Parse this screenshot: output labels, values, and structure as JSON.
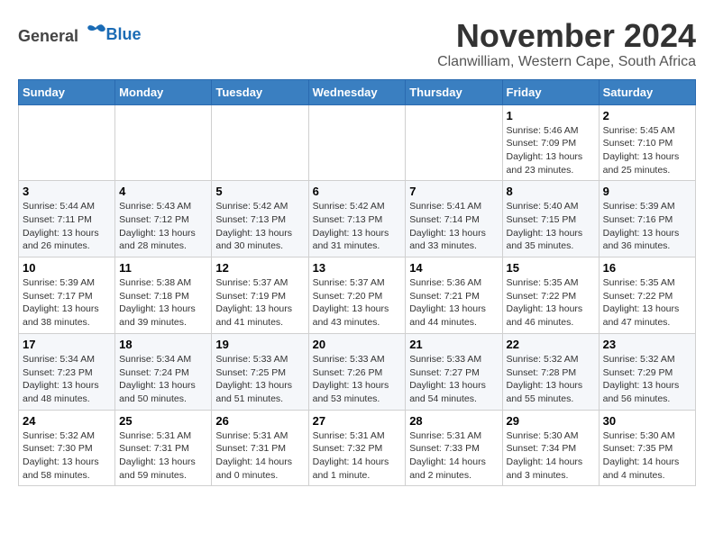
{
  "header": {
    "logo_general": "General",
    "logo_blue": "Blue",
    "month": "November 2024",
    "location": "Clanwilliam, Western Cape, South Africa"
  },
  "weekdays": [
    "Sunday",
    "Monday",
    "Tuesday",
    "Wednesday",
    "Thursday",
    "Friday",
    "Saturday"
  ],
  "weeks": [
    [
      {
        "day": "",
        "info": ""
      },
      {
        "day": "",
        "info": ""
      },
      {
        "day": "",
        "info": ""
      },
      {
        "day": "",
        "info": ""
      },
      {
        "day": "",
        "info": ""
      },
      {
        "day": "1",
        "info": "Sunrise: 5:46 AM\nSunset: 7:09 PM\nDaylight: 13 hours\nand 23 minutes."
      },
      {
        "day": "2",
        "info": "Sunrise: 5:45 AM\nSunset: 7:10 PM\nDaylight: 13 hours\nand 25 minutes."
      }
    ],
    [
      {
        "day": "3",
        "info": "Sunrise: 5:44 AM\nSunset: 7:11 PM\nDaylight: 13 hours\nand 26 minutes."
      },
      {
        "day": "4",
        "info": "Sunrise: 5:43 AM\nSunset: 7:12 PM\nDaylight: 13 hours\nand 28 minutes."
      },
      {
        "day": "5",
        "info": "Sunrise: 5:42 AM\nSunset: 7:13 PM\nDaylight: 13 hours\nand 30 minutes."
      },
      {
        "day": "6",
        "info": "Sunrise: 5:42 AM\nSunset: 7:13 PM\nDaylight: 13 hours\nand 31 minutes."
      },
      {
        "day": "7",
        "info": "Sunrise: 5:41 AM\nSunset: 7:14 PM\nDaylight: 13 hours\nand 33 minutes."
      },
      {
        "day": "8",
        "info": "Sunrise: 5:40 AM\nSunset: 7:15 PM\nDaylight: 13 hours\nand 35 minutes."
      },
      {
        "day": "9",
        "info": "Sunrise: 5:39 AM\nSunset: 7:16 PM\nDaylight: 13 hours\nand 36 minutes."
      }
    ],
    [
      {
        "day": "10",
        "info": "Sunrise: 5:39 AM\nSunset: 7:17 PM\nDaylight: 13 hours\nand 38 minutes."
      },
      {
        "day": "11",
        "info": "Sunrise: 5:38 AM\nSunset: 7:18 PM\nDaylight: 13 hours\nand 39 minutes."
      },
      {
        "day": "12",
        "info": "Sunrise: 5:37 AM\nSunset: 7:19 PM\nDaylight: 13 hours\nand 41 minutes."
      },
      {
        "day": "13",
        "info": "Sunrise: 5:37 AM\nSunset: 7:20 PM\nDaylight: 13 hours\nand 43 minutes."
      },
      {
        "day": "14",
        "info": "Sunrise: 5:36 AM\nSunset: 7:21 PM\nDaylight: 13 hours\nand 44 minutes."
      },
      {
        "day": "15",
        "info": "Sunrise: 5:35 AM\nSunset: 7:22 PM\nDaylight: 13 hours\nand 46 minutes."
      },
      {
        "day": "16",
        "info": "Sunrise: 5:35 AM\nSunset: 7:22 PM\nDaylight: 13 hours\nand 47 minutes."
      }
    ],
    [
      {
        "day": "17",
        "info": "Sunrise: 5:34 AM\nSunset: 7:23 PM\nDaylight: 13 hours\nand 48 minutes."
      },
      {
        "day": "18",
        "info": "Sunrise: 5:34 AM\nSunset: 7:24 PM\nDaylight: 13 hours\nand 50 minutes."
      },
      {
        "day": "19",
        "info": "Sunrise: 5:33 AM\nSunset: 7:25 PM\nDaylight: 13 hours\nand 51 minutes."
      },
      {
        "day": "20",
        "info": "Sunrise: 5:33 AM\nSunset: 7:26 PM\nDaylight: 13 hours\nand 53 minutes."
      },
      {
        "day": "21",
        "info": "Sunrise: 5:33 AM\nSunset: 7:27 PM\nDaylight: 13 hours\nand 54 minutes."
      },
      {
        "day": "22",
        "info": "Sunrise: 5:32 AM\nSunset: 7:28 PM\nDaylight: 13 hours\nand 55 minutes."
      },
      {
        "day": "23",
        "info": "Sunrise: 5:32 AM\nSunset: 7:29 PM\nDaylight: 13 hours\nand 56 minutes."
      }
    ],
    [
      {
        "day": "24",
        "info": "Sunrise: 5:32 AM\nSunset: 7:30 PM\nDaylight: 13 hours\nand 58 minutes."
      },
      {
        "day": "25",
        "info": "Sunrise: 5:31 AM\nSunset: 7:31 PM\nDaylight: 13 hours\nand 59 minutes."
      },
      {
        "day": "26",
        "info": "Sunrise: 5:31 AM\nSunset: 7:31 PM\nDaylight: 14 hours\nand 0 minutes."
      },
      {
        "day": "27",
        "info": "Sunrise: 5:31 AM\nSunset: 7:32 PM\nDaylight: 14 hours\nand 1 minute."
      },
      {
        "day": "28",
        "info": "Sunrise: 5:31 AM\nSunset: 7:33 PM\nDaylight: 14 hours\nand 2 minutes."
      },
      {
        "day": "29",
        "info": "Sunrise: 5:30 AM\nSunset: 7:34 PM\nDaylight: 14 hours\nand 3 minutes."
      },
      {
        "day": "30",
        "info": "Sunrise: 5:30 AM\nSunset: 7:35 PM\nDaylight: 14 hours\nand 4 minutes."
      }
    ]
  ]
}
